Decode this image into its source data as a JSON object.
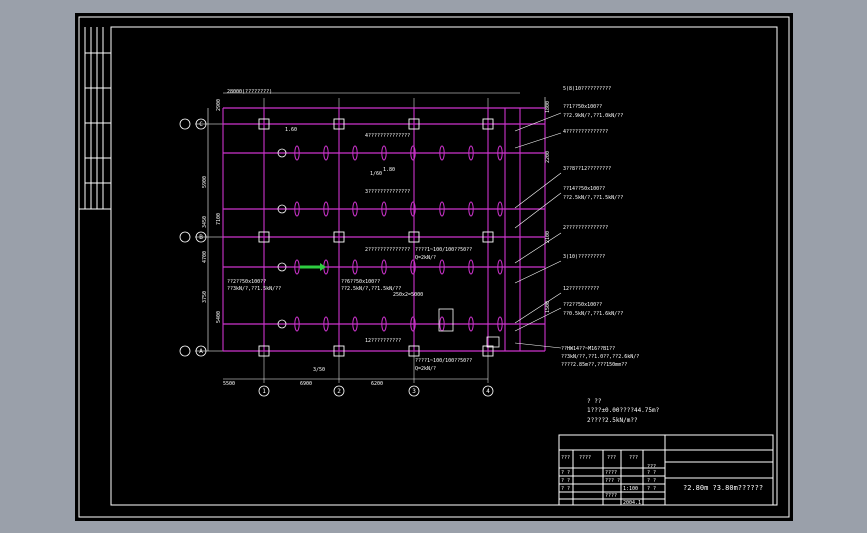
{
  "colors": {
    "background": "#9aa0aa",
    "sheet": "#000000",
    "frame": "#ffffff",
    "beam": "#cc33cc",
    "grid": "#b9b9b9",
    "annotation": "#ffffff",
    "highlight": "#2ecc40"
  },
  "axes": {
    "columns": [
      "1",
      "2",
      "3",
      "4"
    ],
    "rows": [
      "A",
      "B",
      "C"
    ]
  },
  "dimensions": {
    "top_total": "28000(????????)",
    "bottom": [
      "5500",
      "6900",
      "6200"
    ],
    "bottom_short": "3/50",
    "left": [
      "5900",
      "3450",
      "4700",
      "3750"
    ],
    "left_rot": [
      "2900",
      "7100",
      "5400"
    ],
    "mid": [
      "250x2=5000",
      "1/60"
    ],
    "right": [
      "1800",
      "2200",
      "2100",
      "1500"
    ]
  },
  "callouts": {
    "top_right_1": "5(8)10??????????",
    "top_right_2": "??1??50x100??",
    "top_right_3": "??2.9kN/?,??1.0kN/??",
    "top_right_4": "4??????????????",
    "mid_right_1": "3??8??12????????",
    "mid_right_2": "??14??50x100??",
    "mid_right_3": "??2.5kN/?,??1.5kN/??",
    "mid_right_4": "2??????????????",
    "mid_right_5": "3(10)?????????",
    "low_right_1": "12??????????",
    "low_right_2": "??2??50x100??",
    "low_right_3": "??0.5kN/?,??1.6kN/??",
    "bottom_1": "??HW14??~M16??B1??",
    "bottom_2": "??3kN/??,??1.0??,??2.6kN/?",
    "bottom_3": "????2.85m??,???150mm??",
    "inner_1": "4??????????????",
    "inner_2": "3??????????????",
    "inner_3": "2??????????????",
    "inner_4": "12??????????",
    "load_1": "????1~100/100??50??",
    "load_1b": "Q=2kN/?",
    "load_2": "????1~100/100??50??",
    "load_2b": "Q=2kN/?",
    "left_1": "??2??50x100??",
    "left_2": "??3kN/?,??1.5kN/??",
    "center_1": "??6??50x100??",
    "center_2": "??2.5kN/?,??1.5kN/??",
    "small_1": "1.80",
    "small_2": "1.60"
  },
  "notes": {
    "title": "? ??",
    "line1": "1???±0.00????44.75m?",
    "line2": "2????2.5kN/m??"
  },
  "title_block": {
    "row1": [
      "???",
      "????",
      "???",
      "???"
    ],
    "right_label": "???",
    "row2": [
      "? ?",
      "????",
      "? ?",
      "? ?"
    ],
    "row3": [
      "? ?",
      "??? ?",
      "? ?",
      "? ?"
    ],
    "scale": "1:100",
    "row4": [
      "? ?",
      "????",
      "? ?",
      "? ?"
    ],
    "date": "2004.1",
    "drawing_title": "?2.80m  ?3.80m??????"
  }
}
